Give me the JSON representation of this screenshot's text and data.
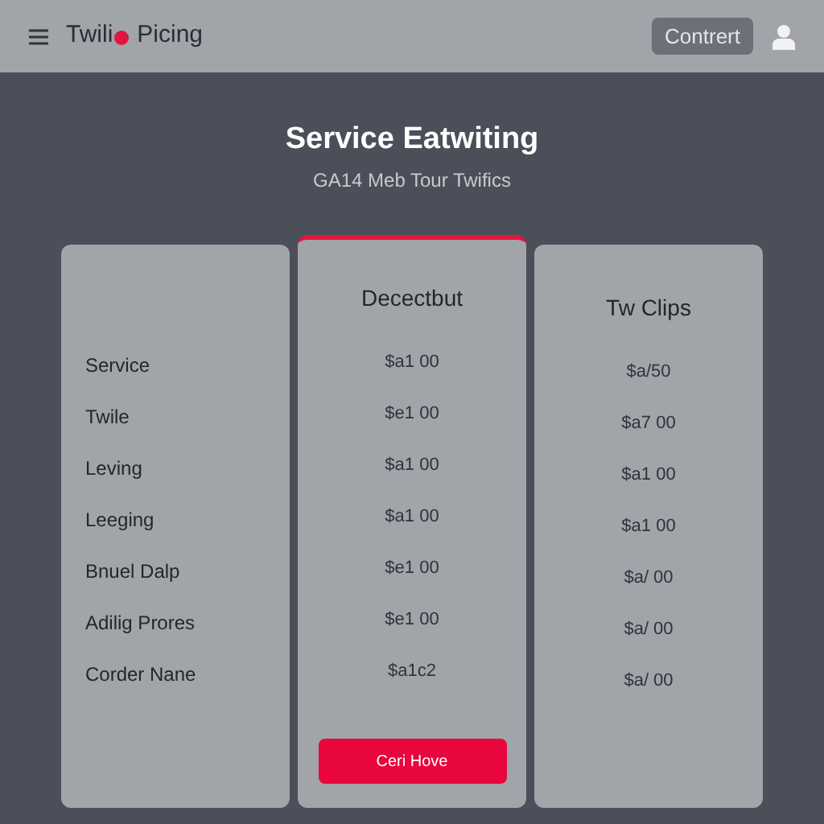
{
  "header": {
    "logo_text": "Twili",
    "logo_suffix": "Picing",
    "button": "Contrert"
  },
  "hero": {
    "title": "Service Eatwiting",
    "subtitle": "GA14 Meb Tour Twifics"
  },
  "features": [
    "Service",
    "Twile",
    "Leving",
    "Leeging",
    "Bnuel Dalp",
    "Adilig Prores",
    "Corder Nane"
  ],
  "plans": [
    {
      "name": "Decectbut",
      "selected": true,
      "prices": [
        "$a1 00",
        "$e1 00",
        "$a1 00",
        "$a1 00",
        "$e1 00",
        "$e1 00",
        "$a1c2"
      ],
      "button": "Ceri Hove"
    },
    {
      "name": "Tw Clips",
      "selected": false,
      "prices": [
        "$a/50",
        "$a7 00",
        "$a1 00",
        "$a1 00",
        "$a/ 00",
        "$a/ 00",
        "$a/ 00"
      ]
    }
  ]
}
